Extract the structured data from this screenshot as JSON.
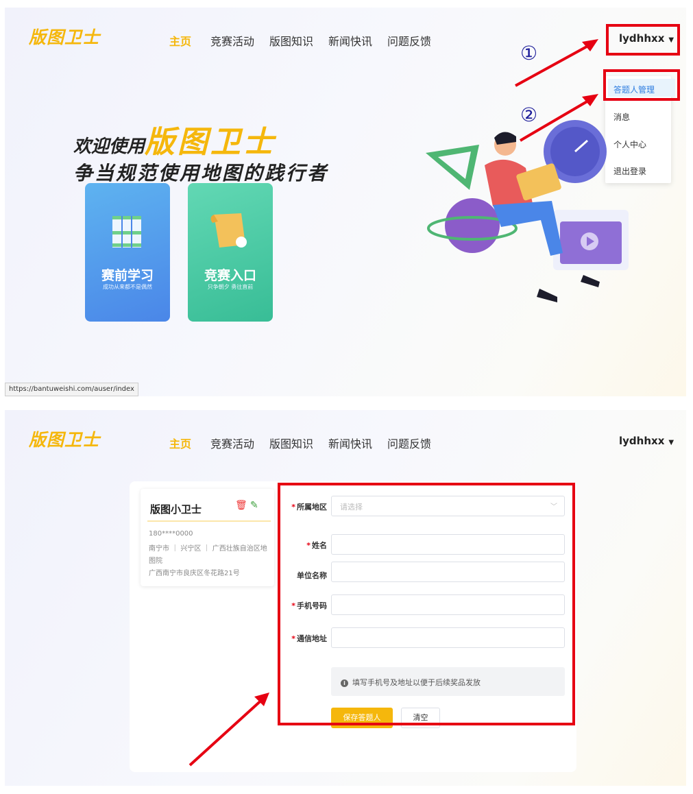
{
  "panel1": {
    "logo": "版图卫士",
    "nav": [
      "主页",
      "竞赛活动",
      "版图知识",
      "新闻快讯",
      "问题反馈"
    ],
    "active_nav": "主页",
    "user": "lydhhxx",
    "dropdown": [
      "答题人管理",
      "消息",
      "个人中心",
      "退出登录"
    ],
    "welcome_prefix": "欢迎使用",
    "welcome_brand": "版图卫士",
    "slogan": "争当规范使用地图的践行者",
    "cards": [
      {
        "title": "赛前学习",
        "sub": "成功从来都不是偶然"
      },
      {
        "title": "竞赛入口",
        "sub": "只争朝夕 勇往直前"
      }
    ],
    "status_url": "https://bantuweishi.com/auser/index",
    "annotations": [
      "①",
      "②"
    ]
  },
  "panel2": {
    "logo": "版图卫士",
    "nav": [
      "主页",
      "竞赛活动",
      "版图知识",
      "新闻快讯",
      "问题反馈"
    ],
    "user": "lydhhxx",
    "person": {
      "name": "版图小卫士",
      "phone": "180****0000",
      "region": "南宁市 ｜ 兴宁区 ｜ 广西壮族自治区地",
      "region2": "图院",
      "address": "广西南宁市良庆区冬花路21号"
    },
    "form": {
      "region_label": "所属地区",
      "region_placeholder": "请选择",
      "name_label": "姓名",
      "org_label": "单位名称",
      "phone_label": "手机号码",
      "address_label": "通信地址",
      "tip": "填写手机号及地址以便于后续奖品发放",
      "save_label": "保存答题人",
      "clear_label": "清空"
    }
  },
  "colors": {
    "accent": "#f5b70c",
    "annotation_red": "#e60012",
    "link_blue": "#2f7ee0"
  }
}
